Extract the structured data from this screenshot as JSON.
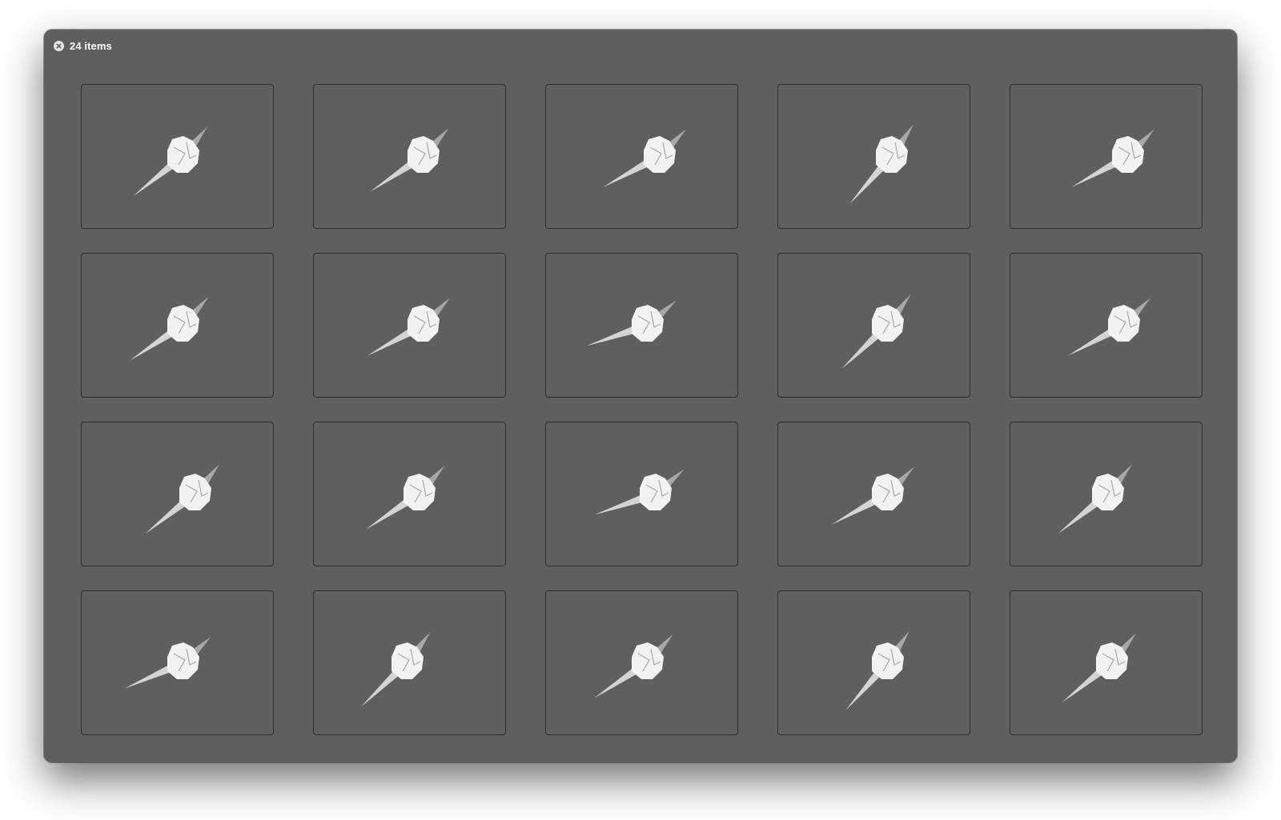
{
  "window": {
    "count_label": "24 items",
    "close_icon": "close-icon"
  },
  "gallery": {
    "item_icon": "crumpled-shape-icon",
    "items": [
      {
        "id": 1
      },
      {
        "id": 2
      },
      {
        "id": 3
      },
      {
        "id": 4
      },
      {
        "id": 5
      },
      {
        "id": 6
      },
      {
        "id": 7
      },
      {
        "id": 8
      },
      {
        "id": 9
      },
      {
        "id": 10
      },
      {
        "id": 11
      },
      {
        "id": 12
      },
      {
        "id": 13
      },
      {
        "id": 14
      },
      {
        "id": 15
      },
      {
        "id": 16
      },
      {
        "id": 17
      },
      {
        "id": 18
      },
      {
        "id": 19
      },
      {
        "id": 20
      }
    ]
  },
  "colors": {
    "window_bg": "#5f5f5f",
    "tile_border": "#2e2e2e",
    "shape_light": "#f2f2f2",
    "shape_mid": "#d4d4d4",
    "shape_dark": "#a8a8a8"
  }
}
